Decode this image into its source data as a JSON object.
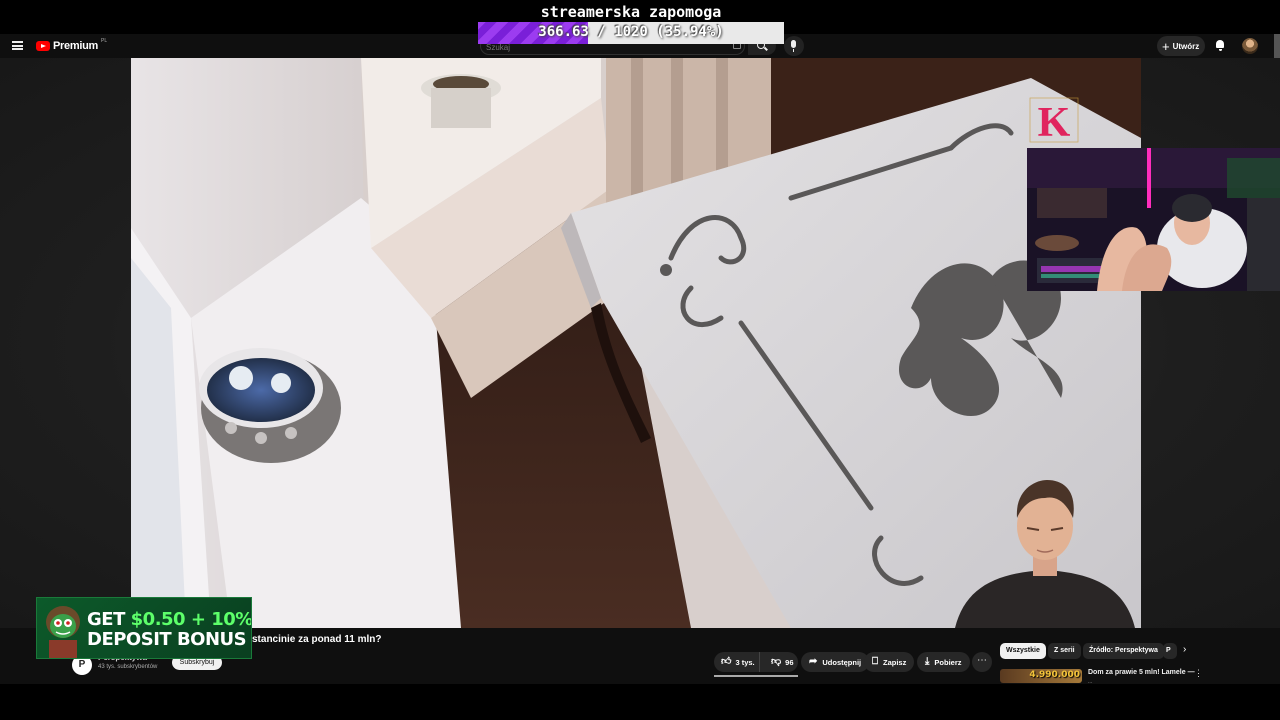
{
  "donation_goal": {
    "title": "streamerska zapomoga",
    "text": "366.63 / 1020 (35.94%)",
    "progress_fraction": 0.3594
  },
  "header": {
    "logo_text": "Premium",
    "logo_region": "PL",
    "search_placeholder": "Szukaj",
    "create_label": "Utwórz"
  },
  "video": {
    "title": "stancinie za ponad 11 mln?",
    "overlay_monogram": "K"
  },
  "channel": {
    "avatar_letter": "P",
    "name": "Perspektywa",
    "subscribers": "43 tys. subskrybentów",
    "subscribe_label": "Subskrybuj"
  },
  "actions": {
    "likes": "3 tys.",
    "dislikes": "96",
    "share_label": "Udostępnij",
    "save_label": "Zapisz",
    "download_label": "Pobierz",
    "more_label": "⋯"
  },
  "chips": [
    {
      "label": "Wszystkie",
      "active": true
    },
    {
      "label": "Z serii",
      "active": false
    },
    {
      "label": "Źródło: Perspektywa",
      "active": false
    },
    {
      "label": "P",
      "active": false
    }
  ],
  "recommendation": {
    "title": "Dom za prawie 5 mln! Lamele —",
    "subtitle": "...",
    "thumb_badge": "4.990.000"
  },
  "ad": {
    "line1_prefix": "GET",
    "line1_amount": "$0.50 + 10%",
    "line2": "DEPOSIT BONUS"
  },
  "colors": {
    "brand_red": "#ff0000",
    "donation_purple": "#7a1fd8",
    "ad_green": "#5dff6a",
    "monogram_pink": "#e0245e"
  }
}
